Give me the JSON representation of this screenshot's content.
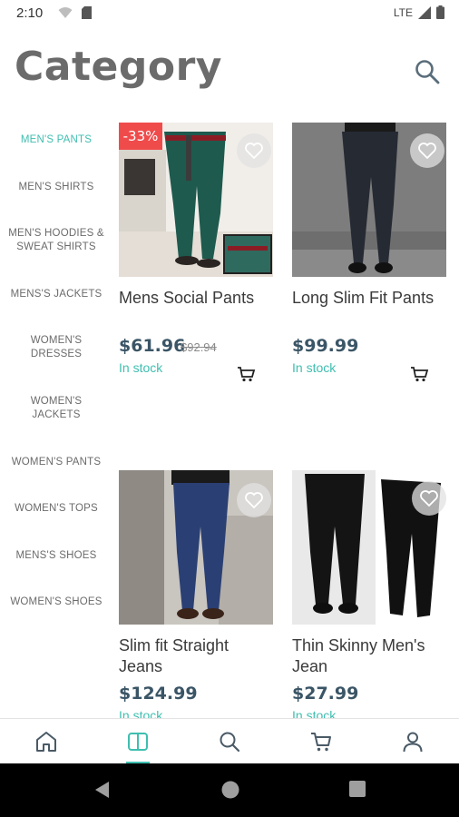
{
  "status_bar": {
    "time": "2:10",
    "network": "LTE"
  },
  "header": {
    "title": "Category"
  },
  "sidebar": {
    "items": [
      {
        "label": "MEN'S PANTS",
        "active": true
      },
      {
        "label": "MEN'S SHIRTS",
        "active": false
      },
      {
        "label": "MEN'S HOODIES & SWEAT SHIRTS",
        "active": false
      },
      {
        "label": "MENS'S JACKETS",
        "active": false
      },
      {
        "label": "WOMEN'S DRESSES",
        "active": false
      },
      {
        "label": "WOMEN'S JACKETS",
        "active": false
      },
      {
        "label": "WOMEN'S PANTS",
        "active": false
      },
      {
        "label": "WOMEN'S TOPS",
        "active": false
      },
      {
        "label": "MENS'S SHOES",
        "active": false
      },
      {
        "label": "WOMEN'S SHOES",
        "active": false
      }
    ]
  },
  "products": [
    {
      "name": "Mens Social Pants",
      "price": "$61.96",
      "old_price": "$92.94",
      "discount": "-33%",
      "stock": "In stock"
    },
    {
      "name": "Long Slim Fit Pants",
      "price": "$99.99",
      "old_price": "",
      "discount": "",
      "stock": "In stock"
    },
    {
      "name": "Slim fit Straight Jeans",
      "price": "$124.99",
      "old_price": "",
      "discount": "",
      "stock": "In stock"
    },
    {
      "name": "Thin Skinny Men's Jean",
      "price": "$27.99",
      "old_price": "",
      "discount": "",
      "stock": "In stock"
    }
  ],
  "bottom_nav": {
    "items": [
      {
        "icon": "home-icon"
      },
      {
        "icon": "category-icon",
        "active": true
      },
      {
        "icon": "search-icon"
      },
      {
        "icon": "cart-icon"
      },
      {
        "icon": "profile-icon"
      }
    ]
  },
  "colors": {
    "accent": "#3fbfb0",
    "discount": "#f04b4b",
    "price": "#3a5566"
  }
}
